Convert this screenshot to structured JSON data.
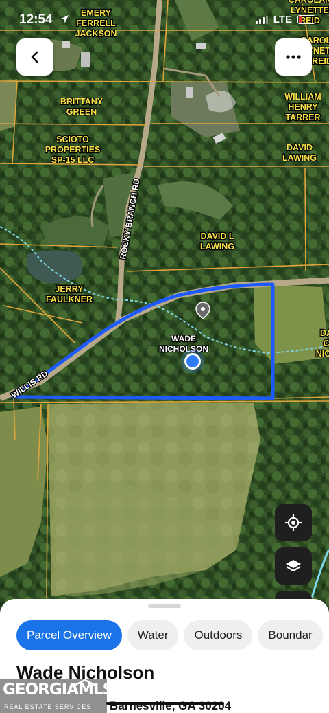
{
  "status_bar": {
    "time": "12:54",
    "network": "LTE",
    "location_icon": "location-arrow-icon",
    "signal_icon": "signal-bars-icon",
    "battery_icon": "battery-low-icon",
    "battery_color": "#e53935"
  },
  "nav": {
    "back_icon": "chevron-left-icon",
    "more_icon": "more-dots-icon"
  },
  "map": {
    "parcel_owners": {
      "emery": [
        "EMERY",
        "FERRELL",
        "JACKSON"
      ],
      "carolan_top": [
        "CAROLAN",
        "LYNETTE",
        "REID"
      ],
      "carolan_mid": [
        "CAROLAN",
        "LYNETTE",
        "REID"
      ],
      "brittany": [
        "BRITTANY",
        "GREEN"
      ],
      "william": [
        "WILLIAM",
        "HENRY",
        "TARRER"
      ],
      "scioto": [
        "SCIOTO",
        "PROPERTIES",
        "SP-15 LLC"
      ],
      "david_lawing": [
        "DAVID",
        "LAWING"
      ],
      "david_l_lawing": [
        "DAVID L",
        "LAWING"
      ],
      "jerry": [
        "JERRY",
        "FAULKNER"
      ],
      "wade_map": [
        "WADE",
        "NICHOLSON"
      ],
      "right_edge": [
        "DA",
        "C",
        "NICH"
      ]
    },
    "roads": {
      "rocky_branch": "ROCKY BRANCH RD",
      "willis": "WILLIS RD"
    },
    "selected_parcel_outline_color": "#1e5bff",
    "parcel_line_color": "#e0a43a",
    "stream_color": "#7fd8e8",
    "user_location_color": "#2f7df6"
  },
  "map_controls": {
    "locate_icon": "crosshair-locate-icon",
    "layers_icon": "layers-icon"
  },
  "sheet": {
    "tabs": [
      "Parcel Overview",
      "Water",
      "Outdoors",
      "Boundar"
    ],
    "active_tab_color": "#1a73e8",
    "title": "Wade Nicholson",
    "address": "Barnesville, GA 30204"
  },
  "watermark": {
    "brand": "GEORGIAMLS",
    "tagline": "REAL ESTATE SERVICES"
  }
}
